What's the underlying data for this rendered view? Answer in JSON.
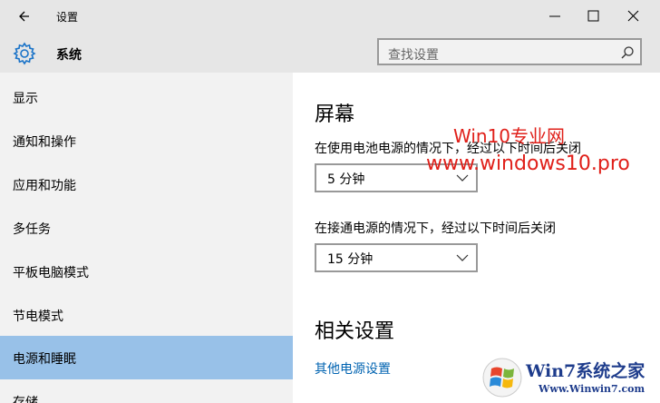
{
  "window": {
    "title": "设置",
    "icons": {
      "back": "back-arrow-icon",
      "minimize": "minimize-icon",
      "maximize": "maximize-icon",
      "close": "close-icon"
    }
  },
  "header": {
    "title": "系统",
    "icon": "gear-icon",
    "search": {
      "placeholder": "查找设置"
    }
  },
  "sidebar": {
    "items": [
      {
        "label": "显示"
      },
      {
        "label": "通知和操作"
      },
      {
        "label": "应用和功能"
      },
      {
        "label": "多任务"
      },
      {
        "label": "平板电脑模式"
      },
      {
        "label": "节电模式"
      },
      {
        "label": "电源和睡眠",
        "active": true
      },
      {
        "label": "存储"
      }
    ]
  },
  "main": {
    "screen_title": "屏幕",
    "battery_label": "在使用电池电源的情况下，经过以下时间后关闭",
    "battery_value": "5 分钟",
    "plugged_label": "在接通电源的情况下，经过以下时间后关闭",
    "plugged_value": "15 分钟",
    "related_title": "相关设置",
    "related_link": "其他电源设置"
  },
  "watermark": {
    "line1": "Win10专业网",
    "line2": "www.windows10.pro",
    "logo_text": "Win7系统之家",
    "logo_url": "Www.Winwin7.com"
  },
  "colors": {
    "accent": "#0063b1",
    "selected": "#98c1e8",
    "watermark": "#e0201a"
  }
}
